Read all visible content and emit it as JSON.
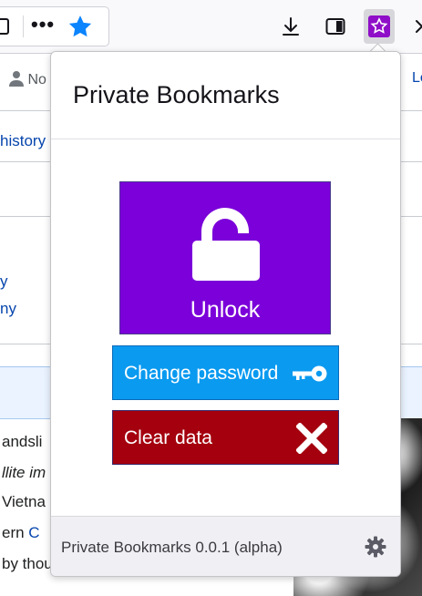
{
  "toolbar": {
    "more_label": "•••",
    "icons": [
      "reader-icon",
      "more-icon",
      "bookmark-star-icon",
      "download-icon",
      "sidebar-icon",
      "private-bookmarks-extension-icon",
      "close-icon"
    ]
  },
  "page": {
    "user_label": "No",
    "right_link": "Lo",
    "tab_label": "history",
    "link_1": "y",
    "link_2": "ny",
    "text_lines": [
      {
        "pre": "andsli",
        "link": "",
        "post": ""
      },
      {
        "pre": "",
        "link": "",
        "post": "llite im"
      },
      {
        "pre": " Vietna",
        "link": "",
        "post": ""
      },
      {
        "pre": "ern ",
        "link": "C",
        "post": ""
      },
      {
        "pre": "by thou",
        "link": "",
        "post": ""
      }
    ]
  },
  "popup": {
    "title": "Private Bookmarks",
    "unlock_label": "Unlock",
    "change_password_label": "Change password",
    "clear_data_label": "Clear data",
    "footer_text": "Private Bookmarks 0.0.1 (alpha)"
  },
  "colors": {
    "unlock": "#7b00d9",
    "change_password": "#0a9af0",
    "clear_data": "#a4000e",
    "star": "#0a84ff"
  }
}
